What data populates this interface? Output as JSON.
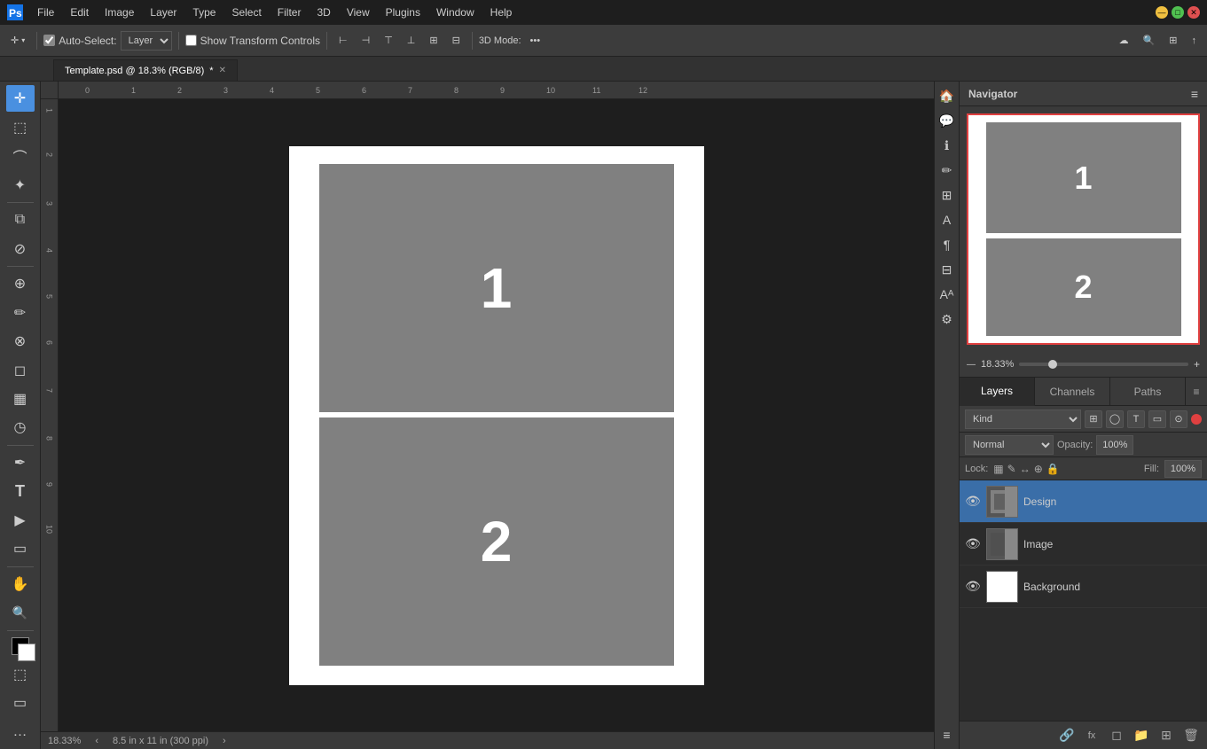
{
  "titlebar": {
    "menus": [
      "PS",
      "File",
      "Edit",
      "Image",
      "Layer",
      "Type",
      "Select",
      "Filter",
      "3D",
      "View",
      "Plugins",
      "Window",
      "Help"
    ],
    "min_label": "—",
    "max_label": "□",
    "close_label": "✕"
  },
  "toolbar": {
    "move_tool": "⊕",
    "auto_select_label": "Auto-Select:",
    "layer_dropdown": "Layer",
    "show_transform": "Show Transform Controls",
    "align_icons": [
      "⊢",
      "⊣",
      "⊤",
      "⊥",
      "⊞",
      "⊟"
    ],
    "mode_label": "3D Mode:",
    "more_label": "•••"
  },
  "tab": {
    "filename": "Template.psd @ 18.3% (RGB/8)",
    "modified": "*",
    "close": "✕"
  },
  "canvas": {
    "slot1_label": "1",
    "slot2_label": "2",
    "bg_color": "#ffffff",
    "slot_color": "#808080",
    "slot_text_color": "#ffffff"
  },
  "navigator": {
    "title": "Navigator",
    "nav_slot1": "1",
    "nav_slot2": "2",
    "zoom_value": "18.33%",
    "zoom_min": "—",
    "zoom_max": "+"
  },
  "layers": {
    "tabs": [
      {
        "id": "layers",
        "label": "Layers"
      },
      {
        "id": "channels",
        "label": "Channels"
      },
      {
        "id": "paths",
        "label": "Paths"
      }
    ],
    "active_tab": "layers",
    "filter_label": "Kind",
    "filter_icons": [
      "⊞",
      "◯",
      "T",
      "▭",
      "⊙",
      "●"
    ],
    "blend_mode": "Normal",
    "opacity_label": "Opacity:",
    "opacity_value": "100%",
    "lock_label": "Lock:",
    "lock_icons": [
      "▭",
      "✎",
      "↔",
      "⊕",
      "🔒"
    ],
    "fill_label": "Fill:",
    "fill_value": "100%",
    "layer_items": [
      {
        "id": "design",
        "name": "Design",
        "visible": true,
        "selected": true,
        "has_mask": true,
        "thumb_type": "design"
      },
      {
        "id": "image",
        "name": "Image",
        "visible": true,
        "selected": false,
        "has_mask": true,
        "thumb_type": "image"
      },
      {
        "id": "background",
        "name": "Background",
        "visible": true,
        "selected": false,
        "has_mask": false,
        "thumb_type": "white"
      }
    ],
    "footer_icons": [
      "🔗",
      "fx",
      "⊞",
      "◻",
      "🗑"
    ]
  },
  "status_bar": {
    "zoom": "18.33%",
    "dimensions": "8.5 in x 11 in (300 ppi)",
    "arrow_right": "›",
    "arrow_left": "‹"
  },
  "tools": {
    "items": [
      {
        "id": "move",
        "icon": "✛",
        "active": true
      },
      {
        "id": "marquee-rect",
        "icon": "⬚"
      },
      {
        "id": "lasso",
        "icon": "⌒"
      },
      {
        "id": "magic-wand",
        "icon": "✦"
      },
      {
        "id": "crop",
        "icon": "⧉"
      },
      {
        "id": "eyedropper",
        "icon": "🔬"
      },
      {
        "id": "spot-heal",
        "icon": "⊕"
      },
      {
        "id": "brush",
        "icon": "🖌"
      },
      {
        "id": "clone",
        "icon": "⊗"
      },
      {
        "id": "eraser",
        "icon": "◻"
      },
      {
        "id": "gradient",
        "icon": "▦"
      },
      {
        "id": "dodge",
        "icon": "◷"
      },
      {
        "id": "pen",
        "icon": "✒"
      },
      {
        "id": "type",
        "icon": "T"
      },
      {
        "id": "path-select",
        "icon": "▶"
      },
      {
        "id": "shape",
        "icon": "▭"
      },
      {
        "id": "hand",
        "icon": "✋"
      },
      {
        "id": "zoom",
        "icon": "🔍"
      },
      {
        "id": "more",
        "icon": "…"
      }
    ],
    "fg_color": "#000000",
    "bg_color": "#ffffff"
  }
}
